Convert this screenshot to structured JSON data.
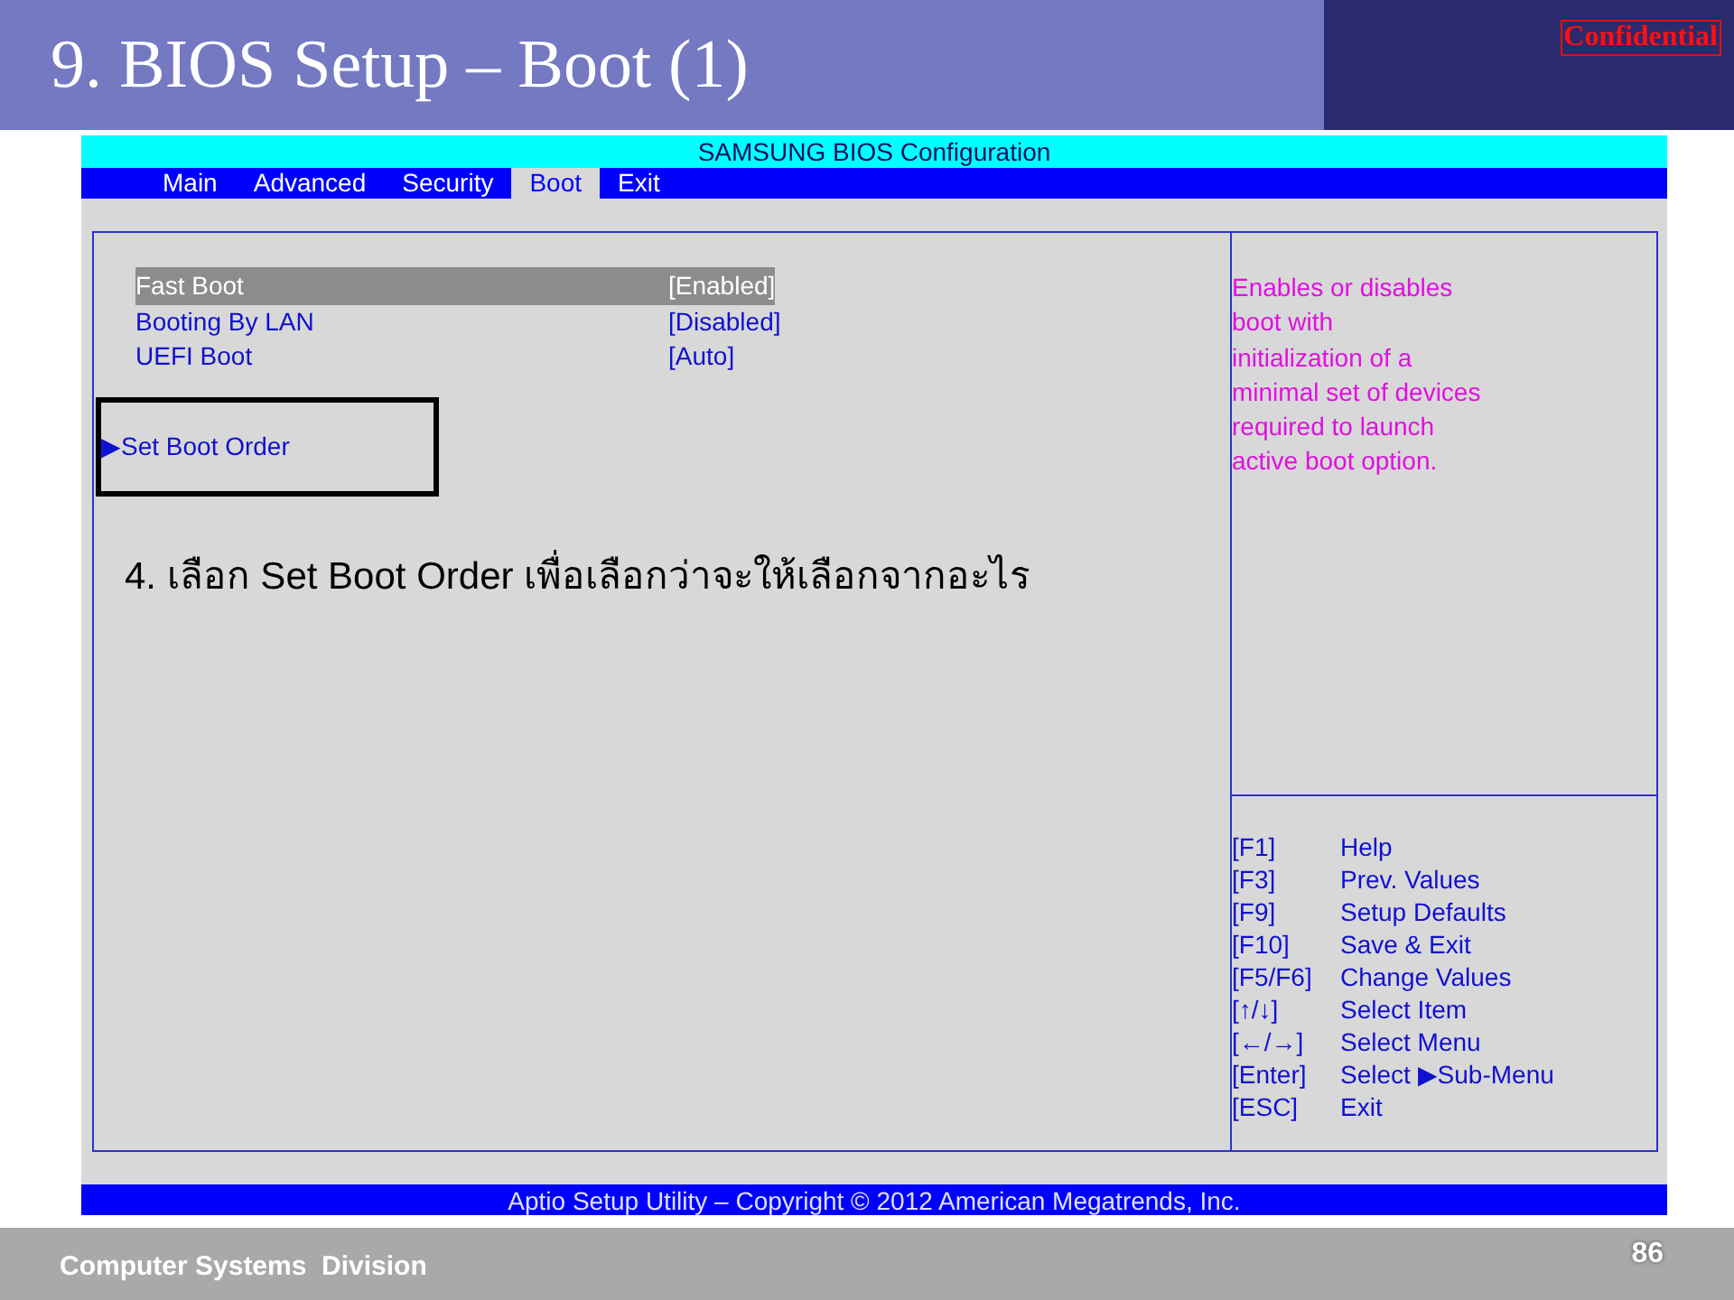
{
  "slide": {
    "title": "9. BIOS Setup – Boot (1)",
    "badge": "Confidential",
    "footer": "Computer Systems  Division",
    "page_number": "86"
  },
  "bios": {
    "title": "SAMSUNG BIOS Configuration",
    "tabs": [
      {
        "label": "Main",
        "selected": false
      },
      {
        "label": "Advanced",
        "selected": false
      },
      {
        "label": "Security",
        "selected": false
      },
      {
        "label": "Boot",
        "selected": true
      },
      {
        "label": "Exit",
        "selected": false
      }
    ],
    "items": [
      {
        "kind": "setting",
        "label": "Fast Boot",
        "value": "[Enabled]",
        "selected": true
      },
      {
        "kind": "setting",
        "label": "Booting By LAN",
        "value": "[Disabled]",
        "selected": false
      },
      {
        "kind": "setting",
        "label": "UEFI Boot",
        "value": "[Auto]",
        "selected": false
      },
      {
        "kind": "submenu",
        "marker": "▶",
        "label": "Set Boot Order",
        "selected": false,
        "annotated": true
      }
    ],
    "annotation": "4. เลือก Set Boot Order เพื่อเลือกว่าจะให้เลือกจากอะไร",
    "help": "Enables or disables\nboot with\ninitialization of a\nminimal set of devices\nrequired to launch\nactive boot option.",
    "keys": [
      {
        "key": "[F1]",
        "action": "Help"
      },
      {
        "key": "[F3]",
        "action": "Prev. Values"
      },
      {
        "key": "[F9]",
        "action": "Setup Defaults"
      },
      {
        "key": "[F10]",
        "action": "Save & Exit"
      },
      {
        "key": "[F5/F6]",
        "action": "Change Values"
      },
      {
        "key": "[↑/↓]",
        "action": "Select Item"
      },
      {
        "key": "[←/→]",
        "action": "Select Menu"
      },
      {
        "key": "[Enter]",
        "action": "Select ▶Sub-Menu"
      },
      {
        "key": "[ESC]",
        "action": "Exit"
      }
    ],
    "footer": "Aptio Setup Utility – Copyright © 2012 American Megatrends, Inc."
  }
}
